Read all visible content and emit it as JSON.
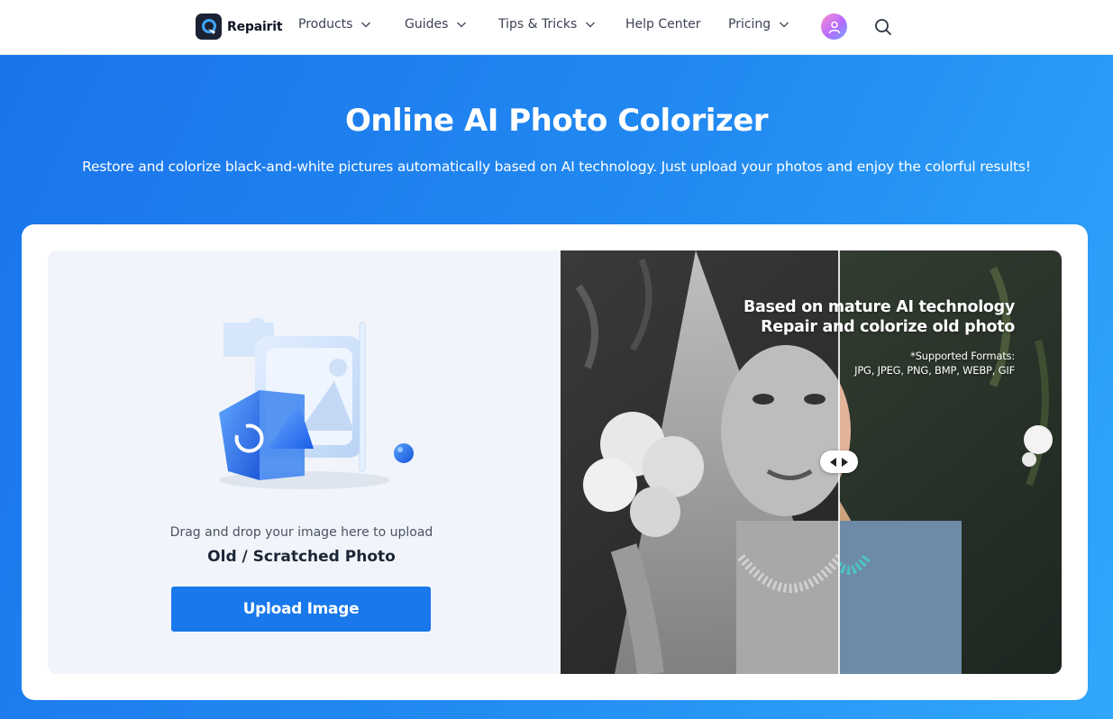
{
  "nav": {
    "brand": "Repairit",
    "items": [
      {
        "label": "Products",
        "has_dropdown": true
      },
      {
        "label": "Guides",
        "has_dropdown": true
      },
      {
        "label": "Tips & Tricks",
        "has_dropdown": true
      },
      {
        "label": "Help Center",
        "has_dropdown": false
      },
      {
        "label": "Pricing",
        "has_dropdown": true
      }
    ],
    "icons": [
      "avatar-icon",
      "search-icon"
    ]
  },
  "hero": {
    "title": "Online AI Photo Colorizer",
    "subtitle": "Restore and colorize black-and-white pictures automatically based on AI technology. Just upload your photos and enjoy the colorful results!"
  },
  "upload": {
    "drag_text": "Drag and drop your image here to upload",
    "photo_type": "Old / Scratched Photo",
    "button_label": "Upload Image"
  },
  "preview": {
    "headline_1": "Based on mature AI technology",
    "headline_2": "Repair and colorize old photo",
    "formats_label": "*Supported Formats:",
    "formats_list": "JPG, JPEG, PNG, BMP, WEBP, GIF"
  },
  "colors": {
    "brand_blue": "#1878ec",
    "hero_gradient_start": "#1a74ec",
    "hero_gradient_end": "#31a7fb",
    "panel_bg": "#f1f4fa"
  }
}
